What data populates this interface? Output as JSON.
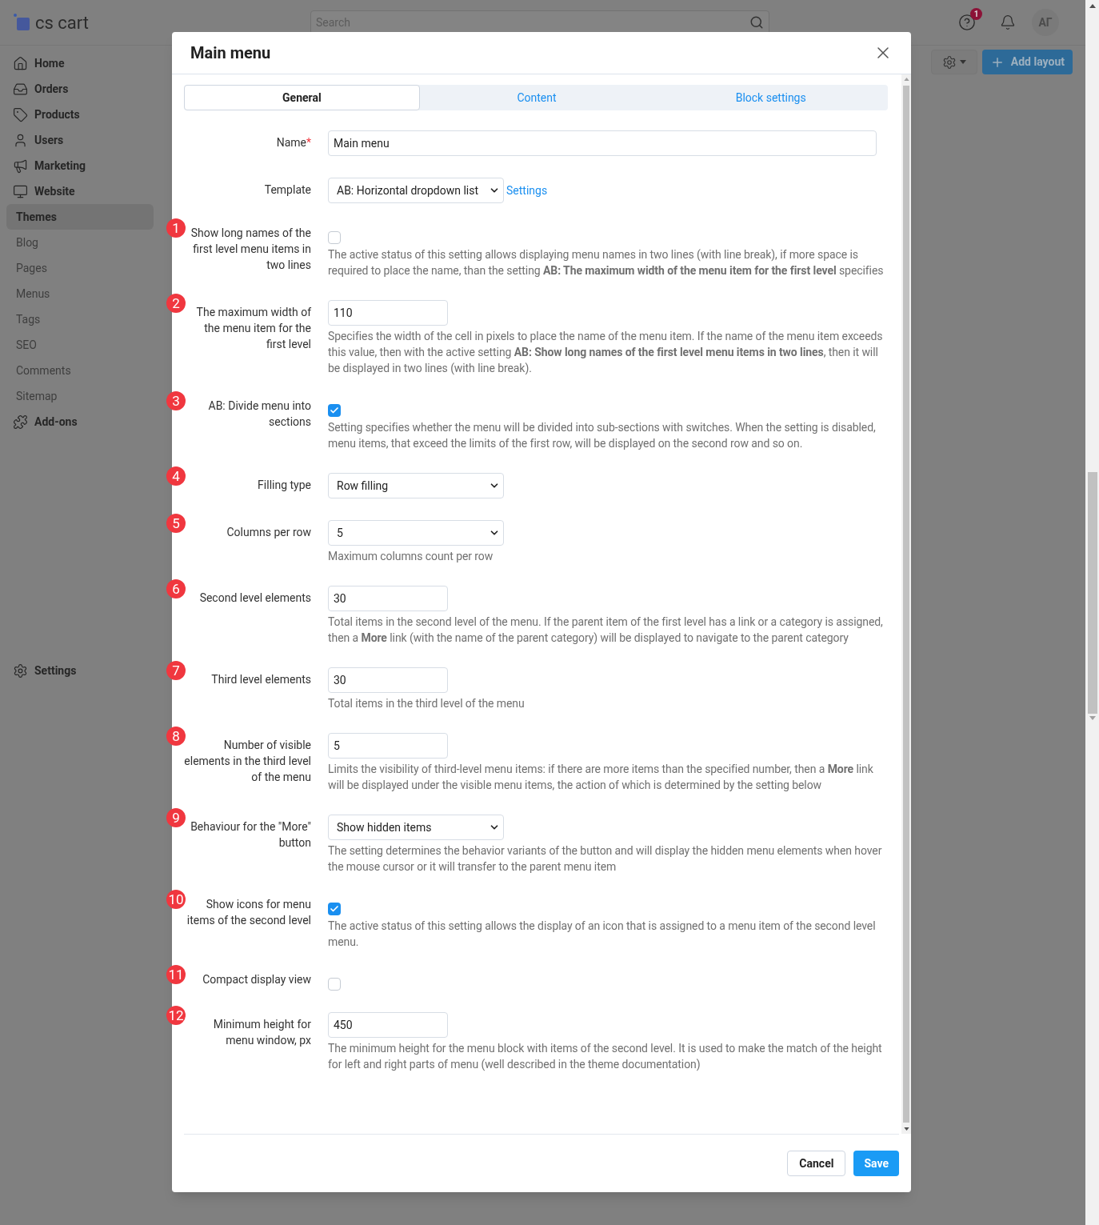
{
  "app": {
    "logo": "cs cart",
    "search": {
      "placeholder": "Search"
    },
    "help_count": "1",
    "avatar": "АГ",
    "sidebar": {
      "items": [
        {
          "label": "Home",
          "kind": "section",
          "selected": false
        },
        {
          "label": "Orders",
          "kind": "section",
          "selected": false
        },
        {
          "label": "Products",
          "kind": "section",
          "selected": false
        },
        {
          "label": "Users",
          "kind": "section",
          "selected": false
        },
        {
          "label": "Marketing",
          "kind": "section",
          "selected": false
        },
        {
          "label": "Website",
          "kind": "section",
          "selected": false
        },
        {
          "label": "Themes",
          "kind": "sub",
          "selected": true
        },
        {
          "label": "Blog",
          "kind": "sub",
          "selected": false
        },
        {
          "label": "Pages",
          "kind": "sub",
          "selected": false
        },
        {
          "label": "Menus",
          "kind": "sub",
          "selected": false
        },
        {
          "label": "Tags",
          "kind": "sub",
          "selected": false
        },
        {
          "label": "SEO",
          "kind": "sub",
          "selected": false
        },
        {
          "label": "Comments",
          "kind": "sub",
          "selected": false
        },
        {
          "label": "Sitemap",
          "kind": "sub",
          "selected": false
        },
        {
          "label": "Add-ons",
          "kind": "section",
          "selected": false
        }
      ],
      "footer": "Settings"
    },
    "add_button": "Add layout"
  },
  "dialog": {
    "title": "Main menu",
    "tabs": [
      {
        "label": "General",
        "selected": true
      },
      {
        "label": "Content",
        "selected": false
      },
      {
        "label": "Block settings",
        "selected": false
      }
    ],
    "fields": [
      {
        "kind": "text",
        "label": "Name",
        "required_mark": "*",
        "value": "Main menu"
      },
      {
        "kind": "select",
        "label": "Template",
        "value": "AB: Horizontal dropdown list",
        "link": "Settings"
      },
      {
        "kind": "checkbox",
        "marker": "1",
        "label": "Show long names of the first level menu items in two lines",
        "checked": false,
        "help": "The active status of this setting allows displaying menu names in two lines (with line break), if more space is required to place the name, than the setting **AB: The maximum width of the menu item for the first level** specifies"
      },
      {
        "kind": "short",
        "marker": "2",
        "label": "The maximum width of the menu item for the first level",
        "value": "110",
        "help": "Specifies the width of the cell in pixels to place the name of the menu item. If the name of the menu item exceeds this value, then with the active setting **AB: Show long names of the first level menu items in two lines**, then it will be displayed in two lines (with line break)."
      },
      {
        "kind": "checkbox",
        "marker": "3",
        "label": "AB: Divide menu into sections",
        "checked": true,
        "help": "Setting specifies whether the menu will be divided into sub-sections with switches. When the setting is disabled, menu items, that exceed the limits of the first row, will be displayed on the second row and so on."
      },
      {
        "kind": "select",
        "marker": "4",
        "label": "Filling type",
        "value": "Row filling"
      },
      {
        "kind": "select",
        "marker": "5",
        "label": "Columns per row",
        "value": "5",
        "help": "Maximum columns count per row"
      },
      {
        "kind": "short",
        "marker": "6",
        "label": "Second level elements",
        "value": "30",
        "help": "Total items in the second level of the menu. If the parent item of the first level has a link or a category is assigned, then a **More** link (with the name of the parent category) will be displayed to navigate to the parent category"
      },
      {
        "kind": "short",
        "marker": "7",
        "label": "Third level elements",
        "value": "30",
        "help": "Total items in the third level of the menu"
      },
      {
        "kind": "short",
        "marker": "8",
        "label": "Number of visible elements in the third level of the menu",
        "value": "5",
        "help": "Limits the visibility of third-level menu items: if there are more items than the specified number, then a **More** link will be displayed under the visible menu items, the action of which is determined by the setting below"
      },
      {
        "kind": "select",
        "marker": "9",
        "label": "Behaviour for the \"More\" button",
        "value": "Show hidden items",
        "help": "The setting determines the behavior variants of the button and will display the hidden menu elements when hover the mouse cursor or it will transfer to the parent menu item"
      },
      {
        "kind": "checkbox",
        "marker": "10",
        "label": "Show icons for menu items of the second level",
        "checked": true,
        "help": "The active status of this setting allows the display of an icon that is assigned to a menu item of the second level menu."
      },
      {
        "kind": "checkbox",
        "marker": "11",
        "label": "Compact display view",
        "checked": false
      },
      {
        "kind": "short",
        "marker": "12",
        "label": "Minimum height for menu window, px",
        "value": "450",
        "help": "The minimum height for the menu block with items of the second level. It is used to make the match of the height for left and right parts of menu (well described in the theme documentation)"
      }
    ],
    "cancel": "Cancel",
    "save": "Save"
  }
}
